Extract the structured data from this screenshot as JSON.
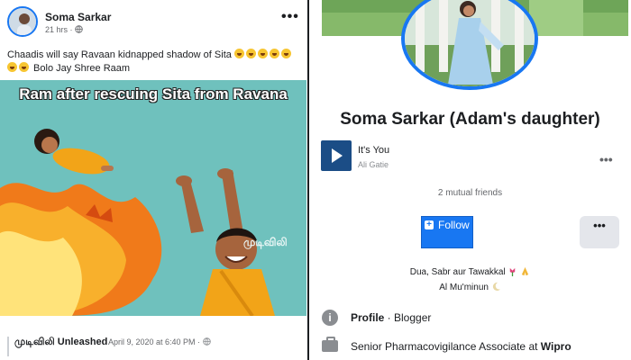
{
  "post": {
    "author": "Soma Sarkar",
    "meta_time": "21 hrs · ",
    "menu_label": "•••",
    "text_line1": "Chaadis will say Ravaan kidnapped shadow of Sita ",
    "text_line2": " Bolo Jay Shree Raam",
    "meme_caption": "Ram after rescuing Sita from Ravana",
    "meme_watermark": "முடிவிலி",
    "shared_page": "முடிவிலி Unleashed",
    "shared_date": "April 9, 2020 at 6:40 PM · "
  },
  "profile": {
    "name": "Soma Sarkar (Adam's daughter)",
    "music_title": "It's You",
    "music_artist": "Ali Gatie",
    "music_menu": "•••",
    "mutual_friends": "2 mutual friends",
    "follow_label": "Follow",
    "more_label": "•••",
    "bio_line1": "Dua, Sabr aur Tawakkal",
    "bio_line2": "Al Mu'minun",
    "info_icon_glyph": "i",
    "profile_label": "Profile",
    "profile_value": " · Blogger",
    "work_text": "Senior Pharmacovigilance Associate at ",
    "work_company": "Wipro"
  },
  "colors": {
    "brand_blue": "#1877f2",
    "meme_background": "#6fc1bd",
    "cover_green": "#7fb263"
  },
  "icons": [
    "globe-icon",
    "laughing-emoji-icon",
    "play-icon",
    "info-icon",
    "briefcase-icon",
    "tulip-icon",
    "praying-hands-icon",
    "crescent-moon-icon"
  ]
}
